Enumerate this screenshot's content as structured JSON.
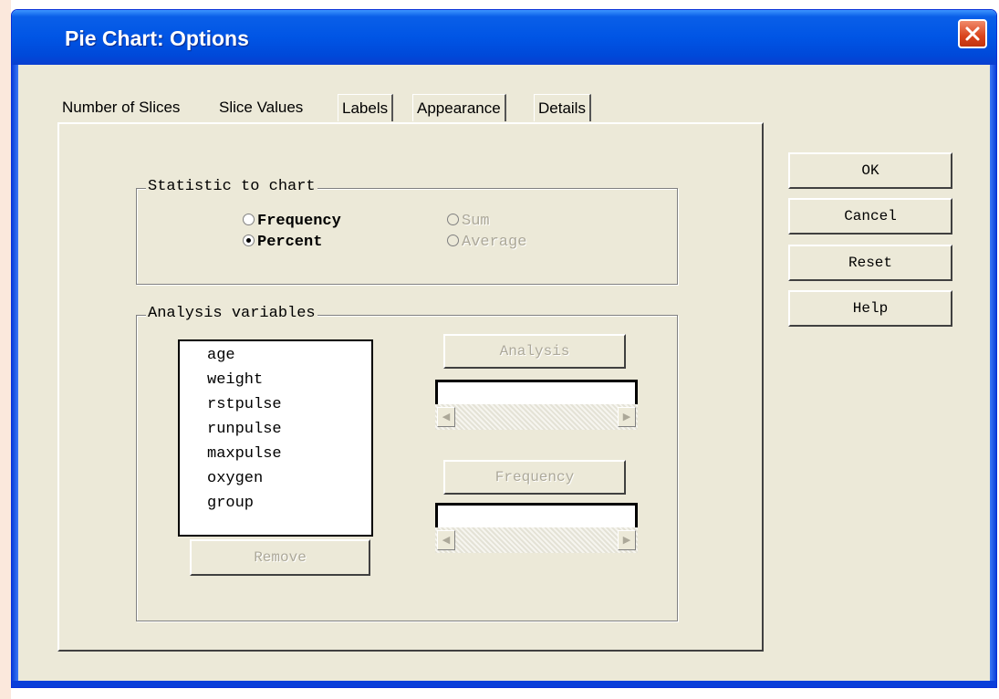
{
  "window": {
    "title": "Pie Chart: Options"
  },
  "tabs": [
    {
      "label": "Number of Slices",
      "active": false
    },
    {
      "label": "Slice Values",
      "active": true
    },
    {
      "label": "Labels",
      "active": false
    },
    {
      "label": "Appearance",
      "active": false
    },
    {
      "label": "Details",
      "active": false
    }
  ],
  "statistic": {
    "legend": "Statistic to chart",
    "options": {
      "frequency": {
        "label": "Frequency",
        "checked": false,
        "enabled": true
      },
      "percent": {
        "label": "Percent",
        "checked": true,
        "enabled": true
      },
      "sum": {
        "label": "Sum",
        "checked": false,
        "enabled": false
      },
      "average": {
        "label": "Average",
        "checked": false,
        "enabled": false
      }
    }
  },
  "analysis": {
    "legend": "Analysis variables",
    "variables": [
      "age",
      "weight",
      "rstpulse",
      "runpulse",
      "maxpulse",
      "oxygen",
      "group"
    ],
    "remove_label": "Remove",
    "analysis_label": "Analysis",
    "frequency_label": "Frequency",
    "analysis_value": "",
    "frequency_value": ""
  },
  "buttons": {
    "ok": "OK",
    "cancel": "Cancel",
    "reset": "Reset",
    "help": "Help"
  },
  "icons": {
    "close": "close-icon",
    "radio": "radio-icon",
    "scroll_left": "arrow-left-icon",
    "scroll_right": "arrow-right-icon"
  },
  "colors": {
    "titlebar": "#0055e5",
    "dialog_bg": "#ece9d8",
    "close_button": "#d9431c",
    "disabled_text": "#aca899"
  }
}
